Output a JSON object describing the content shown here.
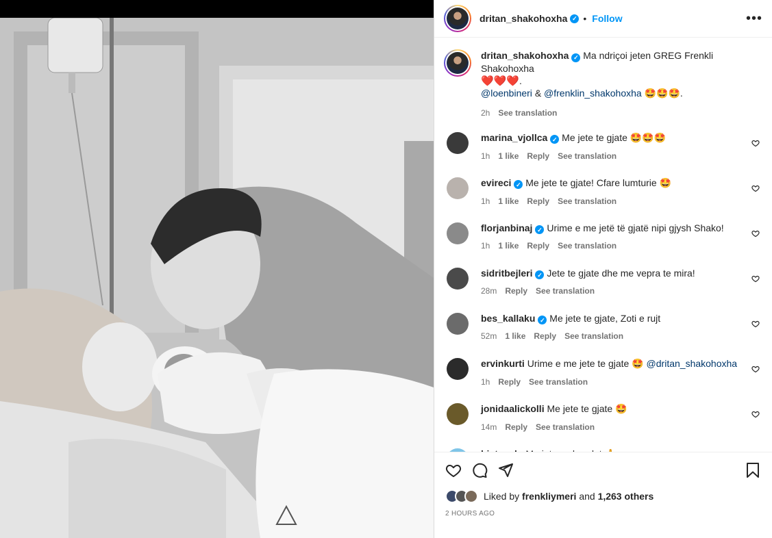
{
  "post": {
    "author": "dritan_shakohoxha",
    "follow_label": "Follow",
    "more_label": "•••",
    "caption": {
      "text": "Ma ndriçoi jeten GREG Frenkli Shakohoxha",
      "hearts": "❤️❤️❤️",
      "period": ".",
      "mention1": "@loenbineri",
      "amp": "&",
      "mention2": "@frenklin_shakohoxha",
      "emojis": "🤩🤩🤩",
      "period2": ".",
      "time": "2h",
      "see_translation": "See translation"
    },
    "liked_by_prefix": "Liked by",
    "liked_by_user": "frenkliymeri",
    "liked_by_and": "and",
    "liked_by_others": "1,263 others",
    "time_ago": "2 HOURS AGO"
  },
  "comments": [
    {
      "user": "marina_vjollca",
      "verified": true,
      "text": "Me jete te gjate",
      "emoji": "🤩🤩🤩",
      "time": "1h",
      "likes": "1 like",
      "reply": "Reply",
      "translate": "See translation",
      "avatar_color": "#3a3a3a"
    },
    {
      "user": "evireci",
      "verified": true,
      "text": "Me jete te gjate! Cfare lumturie",
      "emoji": "🤩",
      "time": "1h",
      "likes": "1 like",
      "reply": "Reply",
      "translate": "See translation",
      "avatar_color": "#b9b2ad"
    },
    {
      "user": "florjanbinaj",
      "verified": true,
      "text": "Urime e me jetë të gjatë nipi gjysh Shako!",
      "emoji": "",
      "time": "1h",
      "likes": "1 like",
      "reply": "Reply",
      "translate": "See translation",
      "avatar_color": "#8a8a8a"
    },
    {
      "user": "sidritbejleri",
      "verified": true,
      "text": "Jete te gjate dhe me vepra te mira!",
      "emoji": "",
      "time": "28m",
      "likes": "",
      "reply": "Reply",
      "translate": "See translation",
      "avatar_color": "#4a4a4a"
    },
    {
      "user": "bes_kallaku",
      "verified": true,
      "text": "Me jete te gjate, Zoti e rujt",
      "emoji": "",
      "time": "52m",
      "likes": "1 like",
      "reply": "Reply",
      "translate": "See translation",
      "avatar_color": "#6b6b6b"
    },
    {
      "user": "ervinkurti",
      "verified": false,
      "text": "Urime e me jete te gjate",
      "emoji": "🤩",
      "mention": "@dritan_shakohoxha",
      "time": "1h",
      "likes": "",
      "reply": "Reply",
      "translate": "See translation",
      "avatar_color": "#2b2b2b"
    },
    {
      "user": "jonidaalickolli",
      "verified": false,
      "text": "Me jete te gjate",
      "emoji": "🤩",
      "time": "14m",
      "likes": "",
      "reply": "Reply",
      "translate": "See translation",
      "avatar_color": "#6a5a2a"
    },
    {
      "user": "bietasulo",
      "verified": false,
      "text": "Me jete e shendet",
      "emoji": "🙏",
      "time": "",
      "likes": "",
      "reply": "",
      "translate": "",
      "avatar_color": "#7fc5e8"
    }
  ],
  "icons": {
    "like": "heart-icon",
    "comment": "comment-icon",
    "share": "share-icon",
    "save": "bookmark-icon"
  },
  "colors": {
    "accent": "#0095f6",
    "text": "#262626",
    "muted": "#737373",
    "mention": "#00376b"
  }
}
